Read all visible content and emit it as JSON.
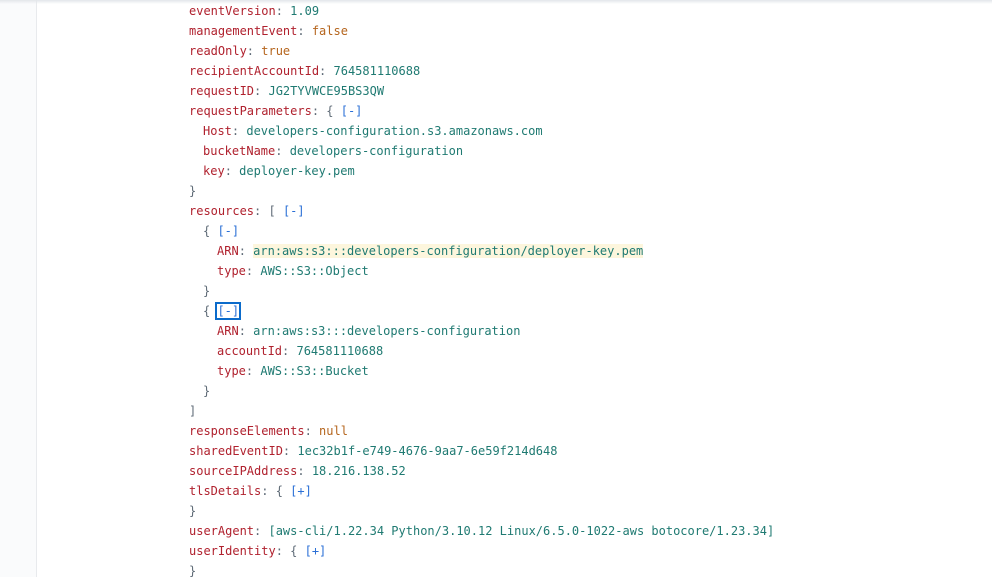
{
  "json_viewer": {
    "lines": [
      {
        "segments": [
          {
            "t": "eventVersion",
            "c": "k"
          },
          {
            "t": ": ",
            "c": "p"
          },
          {
            "t": "1.09",
            "c": "num"
          }
        ]
      },
      {
        "segments": [
          {
            "t": "managementEvent",
            "c": "k"
          },
          {
            "t": ": ",
            "c": "p"
          },
          {
            "t": "false",
            "c": "bool"
          }
        ]
      },
      {
        "segments": [
          {
            "t": "readOnly",
            "c": "k"
          },
          {
            "t": ": ",
            "c": "p"
          },
          {
            "t": "true",
            "c": "bool"
          }
        ]
      },
      {
        "segments": [
          {
            "t": "recipientAccountId",
            "c": "k"
          },
          {
            "t": ": ",
            "c": "p"
          },
          {
            "t": "764581110688",
            "c": "num"
          }
        ]
      },
      {
        "segments": [
          {
            "t": "requestID",
            "c": "k"
          },
          {
            "t": ": ",
            "c": "p"
          },
          {
            "t": "JG2TYVWCE95BS3QW",
            "c": "str"
          }
        ]
      },
      {
        "segments": [
          {
            "t": "requestParameters",
            "c": "k"
          },
          {
            "t": ": { ",
            "c": "p"
          },
          {
            "t": "[-]",
            "c": "tog",
            "name": "collapse-request-parameters-toggle"
          }
        ]
      },
      {
        "segments": [
          {
            "t": "Host",
            "c": "k"
          },
          {
            "t": ": ",
            "c": "p"
          },
          {
            "t": "developers-configuration.s3.amazonaws.com",
            "c": "str"
          }
        ]
      },
      {
        "segments": [
          {
            "t": "bucketName",
            "c": "k"
          },
          {
            "t": ": ",
            "c": "p"
          },
          {
            "t": "developers-configuration",
            "c": "str"
          }
        ]
      },
      {
        "segments": [
          {
            "t": "key",
            "c": "k"
          },
          {
            "t": ": ",
            "c": "p"
          },
          {
            "t": "deployer-key.pem",
            "c": "str"
          }
        ]
      },
      {
        "segments": [
          {
            "t": "}",
            "c": "p"
          }
        ]
      },
      {
        "segments": [
          {
            "t": "resources",
            "c": "k"
          },
          {
            "t": ": [ ",
            "c": "p"
          },
          {
            "t": "[-]",
            "c": "tog",
            "name": "collapse-resources-toggle"
          }
        ]
      },
      {
        "segments": [
          {
            "t": "{ ",
            "c": "p"
          },
          {
            "t": "[-]",
            "c": "tog",
            "name": "collapse-resource-0-toggle"
          }
        ]
      },
      {
        "segments": [
          {
            "t": "ARN",
            "c": "k"
          },
          {
            "t": ": ",
            "c": "p"
          },
          {
            "t": "arn:aws:s3:::developers-configuration/deployer-key.pem",
            "c": "str hl"
          }
        ]
      },
      {
        "segments": [
          {
            "t": "type",
            "c": "k"
          },
          {
            "t": ": ",
            "c": "p"
          },
          {
            "t": "AWS::S3::Object",
            "c": "str"
          }
        ]
      },
      {
        "segments": [
          {
            "t": "}",
            "c": "p"
          }
        ]
      },
      {
        "segments": [
          {
            "t": "{ ",
            "c": "p"
          },
          {
            "t": "[-]",
            "c": "tog focused",
            "name": "collapse-resource-1-toggle"
          }
        ]
      },
      {
        "segments": [
          {
            "t": "ARN",
            "c": "k"
          },
          {
            "t": ": ",
            "c": "p"
          },
          {
            "t": "arn:aws:s3:::developers-configuration",
            "c": "str"
          }
        ]
      },
      {
        "segments": [
          {
            "t": "accountId",
            "c": "k"
          },
          {
            "t": ": ",
            "c": "p"
          },
          {
            "t": "764581110688",
            "c": "num"
          }
        ]
      },
      {
        "segments": [
          {
            "t": "type",
            "c": "k"
          },
          {
            "t": ": ",
            "c": "p"
          },
          {
            "t": "AWS::S3::Bucket",
            "c": "str"
          }
        ]
      },
      {
        "segments": [
          {
            "t": "}",
            "c": "p"
          }
        ]
      },
      {
        "segments": [
          {
            "t": "]",
            "c": "p"
          }
        ]
      },
      {
        "segments": [
          {
            "t": "responseElements",
            "c": "k"
          },
          {
            "t": ": ",
            "c": "p"
          },
          {
            "t": "null",
            "c": "bool"
          }
        ]
      },
      {
        "segments": [
          {
            "t": "sharedEventID",
            "c": "k"
          },
          {
            "t": ": ",
            "c": "p"
          },
          {
            "t": "1ec32b1f-e749-4676-9aa7-6e59f214d648",
            "c": "str"
          }
        ]
      },
      {
        "segments": [
          {
            "t": "sourceIPAddress",
            "c": "k"
          },
          {
            "t": ": ",
            "c": "p"
          },
          {
            "t": "18.216.138.52",
            "c": "str"
          }
        ]
      },
      {
        "segments": [
          {
            "t": "tlsDetails",
            "c": "k"
          },
          {
            "t": ": { ",
            "c": "p"
          },
          {
            "t": "[+]",
            "c": "tog",
            "name": "expand-tls-details-toggle"
          }
        ]
      },
      {
        "segments": [
          {
            "t": "}",
            "c": "p"
          }
        ]
      },
      {
        "segments": [
          {
            "t": "userAgent",
            "c": "k"
          },
          {
            "t": ": ",
            "c": "p"
          },
          {
            "t": "[aws-cli/1.22.34 Python/3.10.12 Linux/6.5.0-1022-aws botocore/1.23.34]",
            "c": "str"
          }
        ]
      },
      {
        "segments": [
          {
            "t": "userIdentity",
            "c": "k"
          },
          {
            "t": ": { ",
            "c": "p"
          },
          {
            "t": "[+]",
            "c": "tog",
            "name": "expand-user-identity-toggle"
          }
        ]
      },
      {
        "segments": [
          {
            "t": "}",
            "c": "p"
          }
        ]
      }
    ]
  },
  "colors": {
    "key": "#b0212e",
    "string": "#1f7a72",
    "boolean": "#b5651d",
    "toggle": "#2a6fd6",
    "highlight": "#fdf6dd"
  }
}
